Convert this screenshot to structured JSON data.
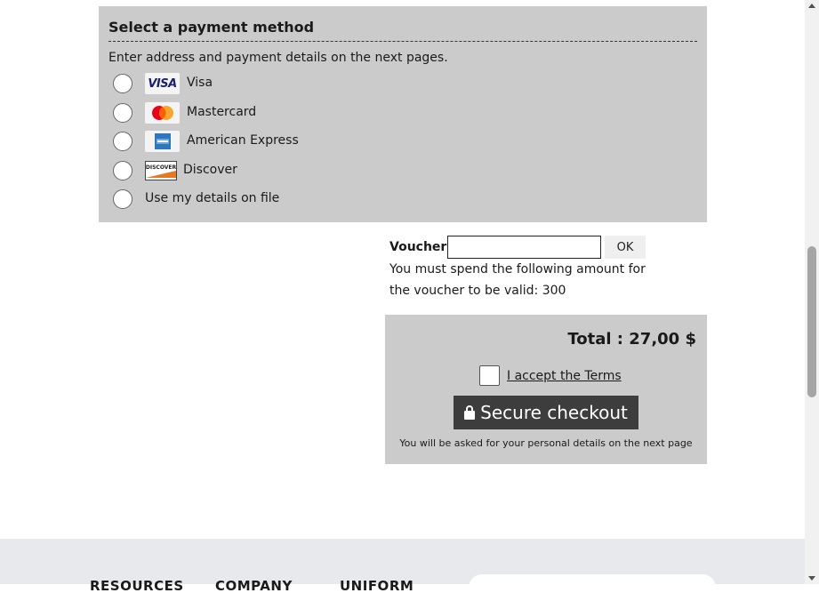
{
  "payment": {
    "title": "Select a payment method",
    "intro": "Enter address and payment details on the next pages.",
    "methods": [
      {
        "label": "Visa",
        "logo": "VISA",
        "icon": "visa-logo"
      },
      {
        "label": "Mastercard",
        "icon": "mastercard-logo"
      },
      {
        "label": "American Express",
        "icon": "amex-logo"
      },
      {
        "label": "Discover",
        "logo": "DISCOVER",
        "icon": "discover-logo"
      },
      {
        "label": "Use my details on file"
      }
    ]
  },
  "voucher": {
    "label": "Voucher",
    "value": "",
    "ok_label": "OK",
    "note": "You must spend the following amount for the voucher to be valid: 300"
  },
  "summary": {
    "total_text": "Total :  27,00 $",
    "terms_text": "I accept the Terms",
    "checkout_label": "Secure checkout",
    "checkout_note": "You will be asked for your personal details on the next page"
  },
  "footer": {
    "headings": [
      "RESOURCES",
      "COMPANY",
      "UNIFORM"
    ]
  },
  "colors": {
    "panel": "#cbcbcb",
    "checkout_button": "#3d3d3d",
    "footer_bg": "#e7e9ec"
  }
}
